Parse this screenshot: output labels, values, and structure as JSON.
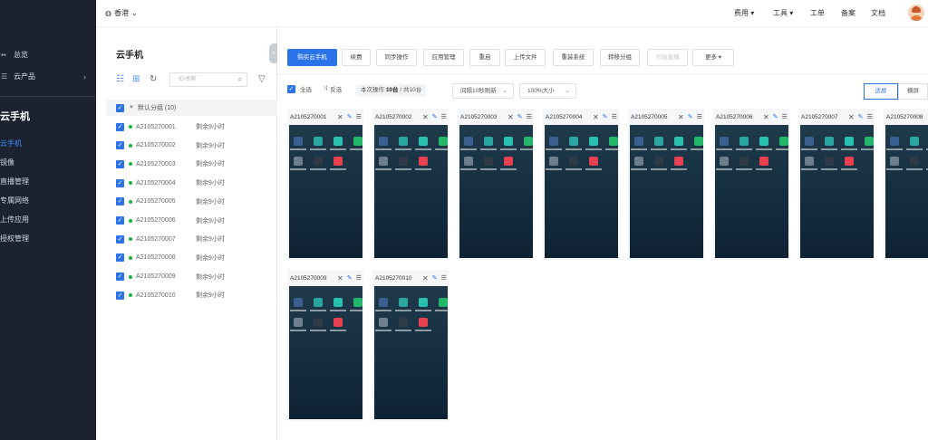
{
  "sidebar": {
    "items": [
      {
        "label": "总览",
        "icon": "grid-icon"
      },
      {
        "label": "云产品",
        "icon": "menu-icon"
      }
    ],
    "section_title": "云手机",
    "sub_items": [
      "云手机",
      "镜像",
      "直播管理",
      "专属网络",
      "上传应用",
      "授权管理"
    ]
  },
  "header": {
    "region": "香港",
    "nav": [
      "费用",
      "工具",
      "工单",
      "备案",
      "文档"
    ]
  },
  "panel": {
    "title": "云手机",
    "search_placeholder": "ID/名称",
    "group": {
      "label": "默认分组 (10)"
    },
    "devices": [
      {
        "id": "A2105270001",
        "remaining": "剩余9小时"
      },
      {
        "id": "A2105270002",
        "remaining": "剩余9小时"
      },
      {
        "id": "A2105270003",
        "remaining": "剩余9小时"
      },
      {
        "id": "A2105270004",
        "remaining": "剩余9小时"
      },
      {
        "id": "A2105270005",
        "remaining": "剩余9小时"
      },
      {
        "id": "A2105270006",
        "remaining": "剩余9小时"
      },
      {
        "id": "A2105270007",
        "remaining": "剩余9小时"
      },
      {
        "id": "A2105270008",
        "remaining": "剩余9小时"
      },
      {
        "id": "A2105270009",
        "remaining": "剩余9小时"
      },
      {
        "id": "A2105270010",
        "remaining": "剩余9小时"
      }
    ]
  },
  "toolbar": {
    "buttons": [
      "购买云手机",
      "续费",
      "同步操作",
      "应用管理",
      "重启",
      "上传文件",
      "重装系统",
      "转移分组",
      "开始直播",
      "更多"
    ]
  },
  "ops": {
    "select_all": "全选",
    "invert": "反选",
    "info_prefix": "本次操作",
    "info_count": "10台",
    "info_suffix": "/ 共10台",
    "refresh": "间隔10秒刷新",
    "size": "100%大小",
    "view_fit": "适屏",
    "view_horizontal": "横屏"
  },
  "cards": [
    "A2105270001",
    "A2105270002",
    "A2105270003",
    "A2105270004",
    "A2105270005",
    "A2105270006",
    "A2105270007",
    "A2105270008",
    "A2105270009",
    "A2105270010"
  ],
  "colors": {
    "primary": "#2b73e8",
    "sidebar_bg": "#1c2230",
    "online": "#19b33e"
  }
}
